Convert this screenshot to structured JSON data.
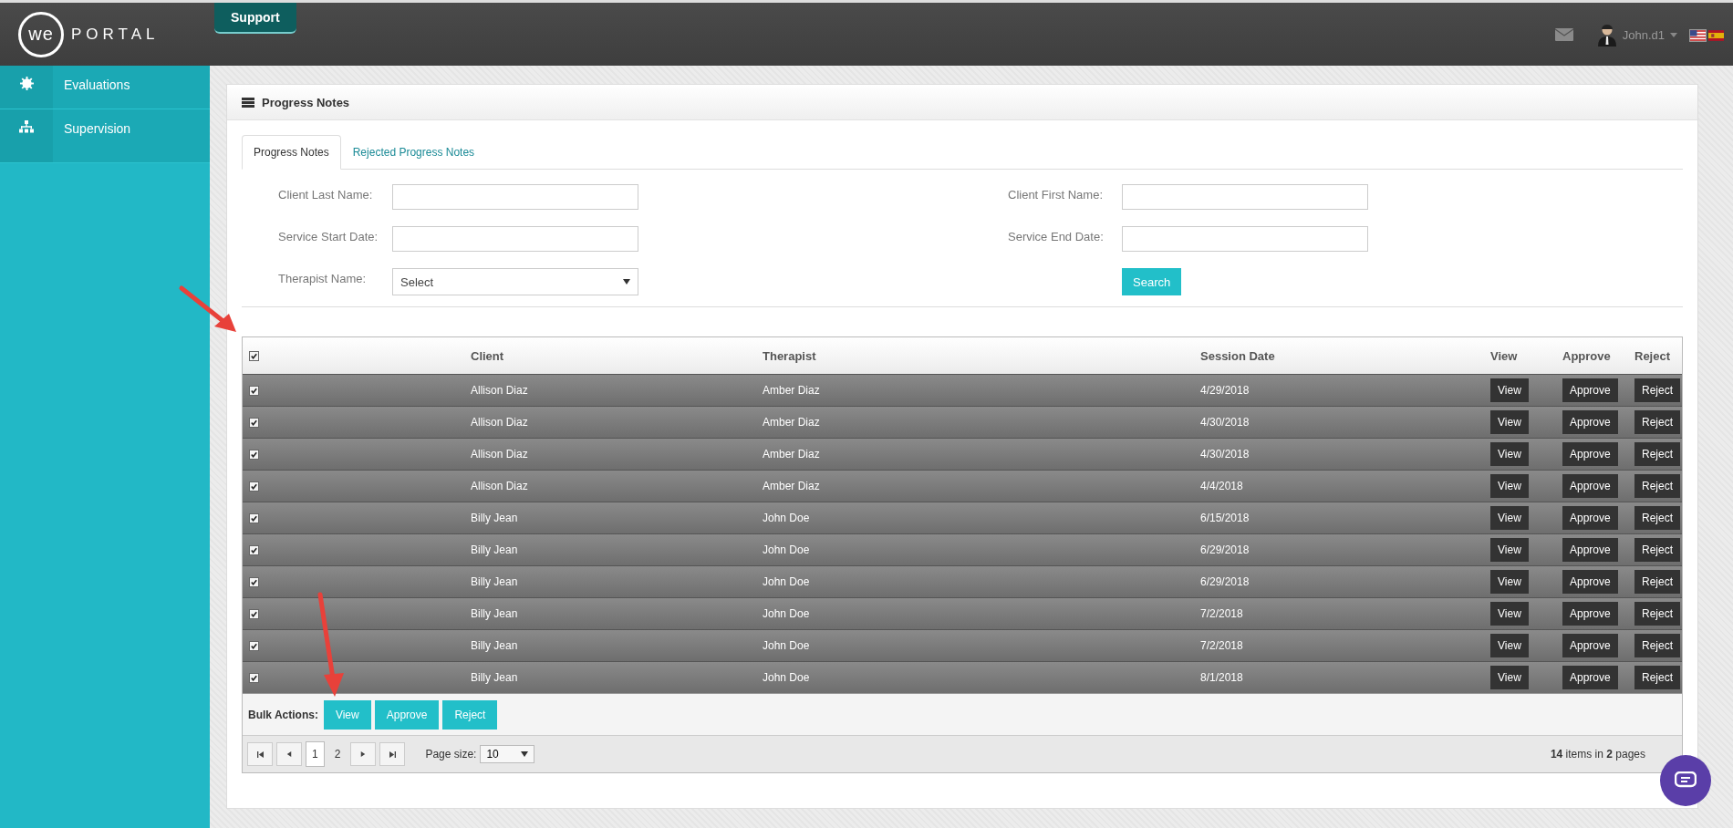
{
  "header": {
    "logo_mark": "we",
    "logo_text": "PORTAL",
    "support_button": "Support",
    "user": "John.d1",
    "flags": [
      {
        "kind": "us",
        "selected": true
      },
      {
        "kind": "es",
        "selected": false
      }
    ]
  },
  "sidebar": {
    "items": [
      {
        "label": "Evaluations",
        "kind": "gear"
      },
      {
        "label": "Supervision",
        "kind": "sitemap"
      }
    ]
  },
  "panel": {
    "title": "Progress Notes",
    "tabs": [
      {
        "label": "Progress Notes",
        "selected": true
      },
      {
        "label": "Rejected Progress Notes",
        "selected": false
      }
    ],
    "filters": {
      "left": [
        {
          "label": "Client Last Name:",
          "kind": "text"
        },
        {
          "label": "Service Start Date:",
          "kind": "text"
        },
        {
          "label": "Therapist Name:",
          "kind": "select",
          "value": "Select"
        }
      ],
      "right": [
        {
          "label": "Client First Name:",
          "kind": "text"
        },
        {
          "label": "Service End Date:",
          "kind": "text"
        }
      ],
      "search_button": "Search"
    },
    "table": {
      "all_checked": true,
      "columns": [
        "Client",
        "Therapist",
        "Session Date",
        "View",
        "Approve",
        "Reject"
      ],
      "rows": [
        {
          "checked": true,
          "client": "Allison Diaz",
          "therapist": "Amber Diaz",
          "date": "4/29/2018",
          "view": "View",
          "approve": "Approve",
          "reject": "Reject"
        },
        {
          "checked": true,
          "client": "Allison Diaz",
          "therapist": "Amber Diaz",
          "date": "4/30/2018",
          "view": "View",
          "approve": "Approve",
          "reject": "Reject"
        },
        {
          "checked": true,
          "client": "Allison Diaz",
          "therapist": "Amber Diaz",
          "date": "4/30/2018",
          "view": "View",
          "approve": "Approve",
          "reject": "Reject"
        },
        {
          "checked": true,
          "client": "Allison Diaz",
          "therapist": "Amber Diaz",
          "date": "4/4/2018",
          "view": "View",
          "approve": "Approve",
          "reject": "Reject"
        },
        {
          "checked": true,
          "client": "Billy Jean",
          "therapist": "John Doe",
          "date": "6/15/2018",
          "view": "View",
          "approve": "Approve",
          "reject": "Reject"
        },
        {
          "checked": true,
          "client": "Billy Jean",
          "therapist": "John Doe",
          "date": "6/29/2018",
          "view": "View",
          "approve": "Approve",
          "reject": "Reject"
        },
        {
          "checked": true,
          "client": "Billy Jean",
          "therapist": "John Doe",
          "date": "6/29/2018",
          "view": "View",
          "approve": "Approve",
          "reject": "Reject"
        },
        {
          "checked": true,
          "client": "Billy Jean",
          "therapist": "John Doe",
          "date": "7/2/2018",
          "view": "View",
          "approve": "Approve",
          "reject": "Reject"
        },
        {
          "checked": true,
          "client": "Billy Jean",
          "therapist": "John Doe",
          "date": "7/2/2018",
          "view": "View",
          "approve": "Approve",
          "reject": "Reject"
        },
        {
          "checked": true,
          "client": "Billy Jean",
          "therapist": "John Doe",
          "date": "8/1/2018",
          "view": "View",
          "approve": "Approve",
          "reject": "Reject"
        }
      ],
      "bulk_label": "Bulk Actions:",
      "bulk_buttons": [
        "View",
        "Approve",
        "Reject"
      ],
      "pages": [
        {
          "label": "1",
          "selected": true
        },
        {
          "label": "2",
          "selected": false
        }
      ],
      "page_size_label": "Page size:",
      "page_size": "10",
      "summary": "**14** items in **2** pages"
    }
  }
}
